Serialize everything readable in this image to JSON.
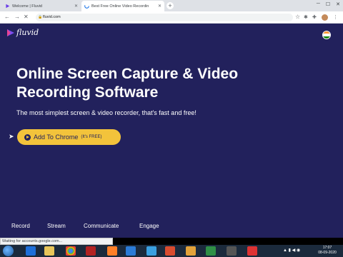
{
  "browser": {
    "tabs": [
      {
        "title": "Welcome | Fluvid"
      },
      {
        "title": "Best Free Online Video Recordin"
      }
    ],
    "url": "fluvid.com",
    "status_text": "Waiting for accounts.google.com..."
  },
  "page": {
    "logo_text": "fluvid",
    "hero_title": "Online Screen Capture & Video Recording Software",
    "hero_subtitle": "The most simplest screen & video recorder, that's fast and free!",
    "cta_label": "Add To Chrome",
    "cta_note": "(It's FREE)",
    "nav_items": [
      "Record",
      "Stream",
      "Communicate",
      "Engage"
    ]
  },
  "taskbar": {
    "time": "17:07",
    "date": "08-09-2020"
  },
  "colors": {
    "page_bg": "#22215c",
    "cta_bg": "#f3c33b",
    "taskbar_bg": "#1b2a3c"
  }
}
